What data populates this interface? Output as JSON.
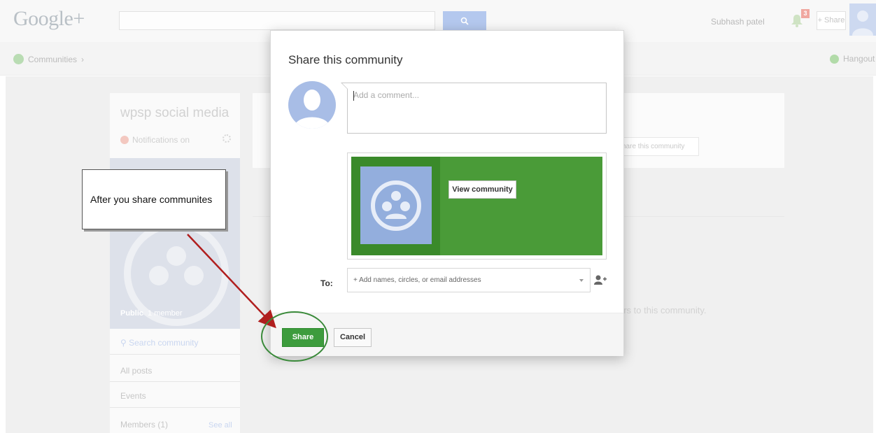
{
  "header": {
    "logo": "Google+",
    "user_name": "Subhash patel",
    "notification_count": "3",
    "share_label": "+ Share"
  },
  "subnav": {
    "communities_label": "Communities",
    "hangouts_label": "Hangout"
  },
  "community": {
    "name": "wpsp social media",
    "notifications_label": "Notifications on",
    "public_label": "Public",
    "members_label": "1 member",
    "search_placeholder": "Search community",
    "nav_items": [
      "All posts",
      "Events",
      "Members (1)"
    ],
    "see_all_label": "See all"
  },
  "main": {
    "share_community_label": "hare this community",
    "members_text": "ers to this community."
  },
  "dialog": {
    "title": "Share this community",
    "comment_placeholder": "Add a comment...",
    "view_community_label": "View community",
    "to_label": "To:",
    "to_placeholder": "+ Add names, circles, or email addresses",
    "share_label": "Share",
    "cancel_label": "Cancel"
  },
  "annotation": {
    "callout_text": "After you share communites",
    "arrow_color": "#b01e1e",
    "highlight_color": "#3a8a3a"
  },
  "colors": {
    "share_green": "#3d9c3d",
    "preview_green": "#4a9b38",
    "preview_image_blue": "#93aedd"
  }
}
